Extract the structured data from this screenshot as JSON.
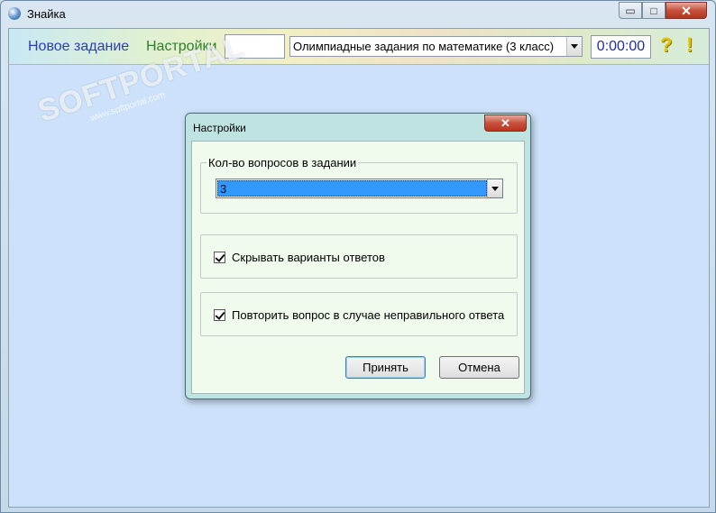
{
  "window": {
    "title": "Знайка",
    "min_glyph": "▭",
    "max_glyph": "□",
    "close_glyph": "✕"
  },
  "toolbar": {
    "new_task": "Новое задание",
    "settings": "Настройки",
    "task_select": "Олимпиадные задания по математике (3 класс)",
    "timer": "0:00:00",
    "help_glyph": "?",
    "alert_glyph": "!"
  },
  "watermark": {
    "line1": "SOFTPORTAL",
    "line2": "www.softportal.com"
  },
  "dialog": {
    "title": "Настройки",
    "close_glyph": "✕",
    "question_count_label": "Кол-во вопросов в задании",
    "question_count_value": "3",
    "hide_answers_label": "Скрывать варианты ответов",
    "repeat_question_label": "Повторить вопрос в случае неправильного ответа",
    "accept_label": "Принять",
    "cancel_label": "Отмена"
  },
  "colors": {
    "accent_select": "#3399ff",
    "new_task_link": "#2b3fae",
    "settings_link": "#2e7f2b",
    "timer_text": "#1f2f9f"
  }
}
